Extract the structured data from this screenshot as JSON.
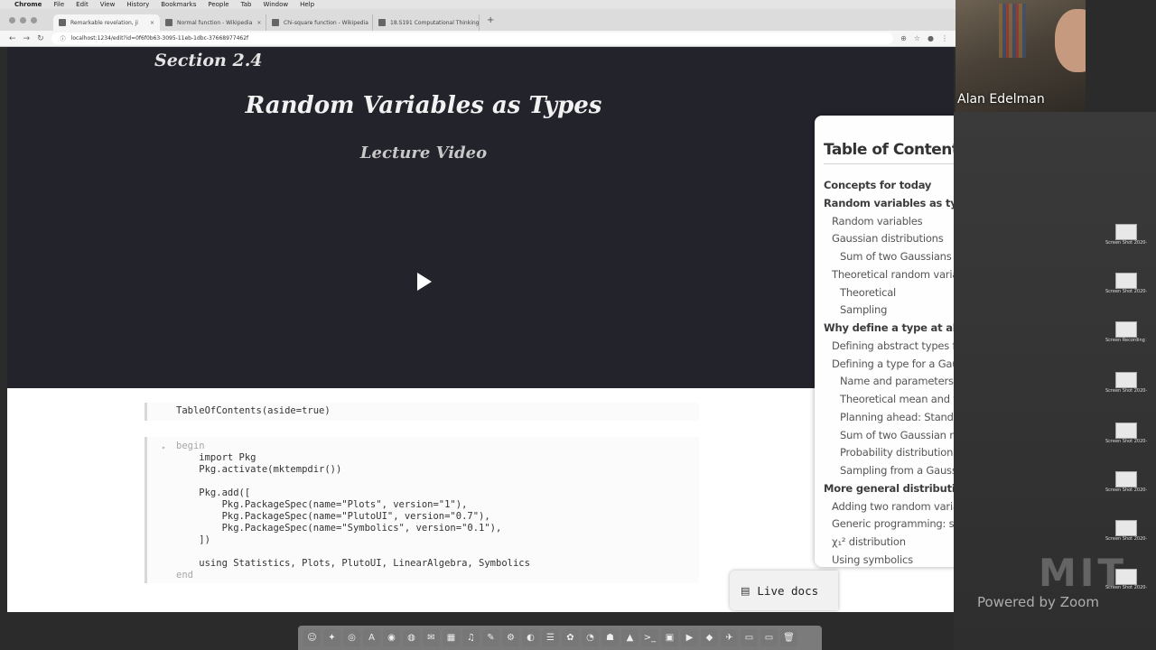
{
  "menubar": {
    "app": "Chrome",
    "items": [
      "File",
      "Edit",
      "View",
      "History",
      "Bookmarks",
      "People",
      "Tab",
      "Window",
      "Help"
    ]
  },
  "browser": {
    "tabs": [
      {
        "label": "Remarkable revelation, ji",
        "active": true
      },
      {
        "label": "Normal function - Wikipedia",
        "active": false
      },
      {
        "label": "Chi-square function - Wikipedia",
        "active": false
      },
      {
        "label": "18.S191 Computational Thinking",
        "active": false
      }
    ],
    "url": "localhost:1234/edit?id=0f6f0b63-3095-11eb-1dbc-37668977462f"
  },
  "notebook": {
    "section": "Section 2.4",
    "title": "Random Variables as Types",
    "subtitle": "Lecture Video",
    "cell1": "TableOfContents(aside=true)",
    "cell2": [
      "begin",
      "    import Pkg",
      "    Pkg.activate(mktempdir())",
      "",
      "    Pkg.add([",
      "        Pkg.PackageSpec(name=\"Plots\", version=\"1\"),",
      "        Pkg.PackageSpec(name=\"PlutoUI\", version=\"0.7\"),",
      "        Pkg.PackageSpec(name=\"Symbolics\", version=\"0.1\"),",
      "    ])",
      "",
      "    using Statistics, Plots, PlutoUI, LinearAlgebra, Symbolics",
      "end"
    ]
  },
  "toc": {
    "title": "Table of Contents",
    "items": [
      {
        "level": 1,
        "text": "Concepts for today"
      },
      {
        "level": 1,
        "text": "Random variables as types"
      },
      {
        "level": 2,
        "text": "Random variables"
      },
      {
        "level": 2,
        "text": "Gaussian distributions"
      },
      {
        "level": 3,
        "text": "Sum of two Gaussians"
      },
      {
        "level": 2,
        "text": "Theoretical random variables vs. sampling"
      },
      {
        "level": 3,
        "text": "Theoretical"
      },
      {
        "level": 3,
        "text": "Sampling"
      },
      {
        "level": 1,
        "text": "Why define a type at all?"
      },
      {
        "level": 2,
        "text": "Defining abstract types for random variables"
      },
      {
        "level": 2,
        "text": "Defining a type for a Gaussian random variable"
      },
      {
        "level": 3,
        "text": "Name and parameters"
      },
      {
        "level": 3,
        "text": "Theoretical mean and variance"
      },
      {
        "level": 3,
        "text": "Planning ahead: Standard deviation for any ..."
      },
      {
        "level": 3,
        "text": "Sum of two Gaussian random variables"
      },
      {
        "level": 3,
        "text": "Probability distribution of a Gaussian"
      },
      {
        "level": 3,
        "text": "Sampling from a Gaussian distribution"
      },
      {
        "level": 1,
        "text": "More general distributions"
      },
      {
        "level": 2,
        "text": "Adding two random variables"
      },
      {
        "level": 2,
        "text": "Generic programming: sum"
      },
      {
        "level": 2,
        "text": "χ₁² distribution"
      },
      {
        "level": 2,
        "text": "Using symbolics"
      }
    ]
  },
  "live_docs": "Live docs",
  "zoom": {
    "participant": "Alan Edelman",
    "watermark": "Powered by Zoom"
  },
  "desktop_icons": [
    {
      "caption": "Screen Shot 2020-10...8.24 AM"
    },
    {
      "caption": "Screen Shot 2020-10...8.24 AM"
    },
    {
      "caption": "Screen Recording 2020-10...AM.mov"
    },
    {
      "caption": "Screen Shot 2020-10...8.03 AM"
    },
    {
      "caption": "Screen Shot 2020-10...1.58 AM"
    },
    {
      "caption": "Screen Shot 2020-10...8.31 AM"
    },
    {
      "caption": "Screen Shot 2020-10...8.11 AM"
    },
    {
      "caption": "Screen Shot 2020-10...8.37 AM"
    }
  ]
}
